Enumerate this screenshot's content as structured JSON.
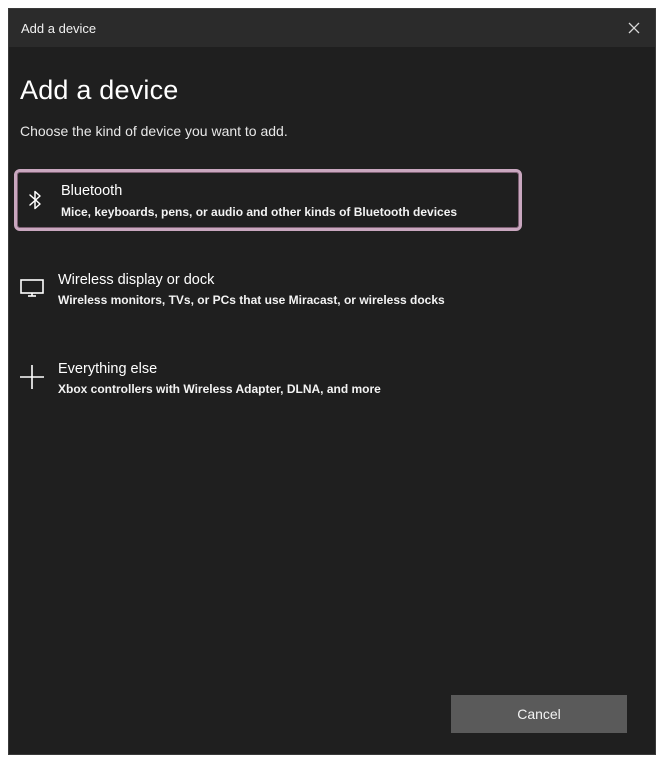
{
  "window": {
    "title": "Add a device",
    "close_icon": "close-icon"
  },
  "main": {
    "heading": "Add a device",
    "subheading": "Choose the kind of device you want to add."
  },
  "options": [
    {
      "title": "Bluetooth",
      "description": "Mice, keyboards, pens, or audio and other kinds of Bluetooth devices",
      "icon": "bluetooth-icon",
      "selected": true
    },
    {
      "title": "Wireless display or dock",
      "description": "Wireless monitors, TVs, or PCs that use Miracast, or wireless docks",
      "icon": "monitor-icon",
      "selected": false
    },
    {
      "title": "Everything else",
      "description": "Xbox controllers with Wireless Adapter, DLNA, and more",
      "icon": "plus-icon",
      "selected": false
    }
  ],
  "footer": {
    "cancel_label": "Cancel"
  },
  "colors": {
    "background": "#1f1f1f",
    "title_bar": "#2b2b2b",
    "selection_border": "#c9a7bf",
    "cancel_button": "#5a5a5a"
  }
}
